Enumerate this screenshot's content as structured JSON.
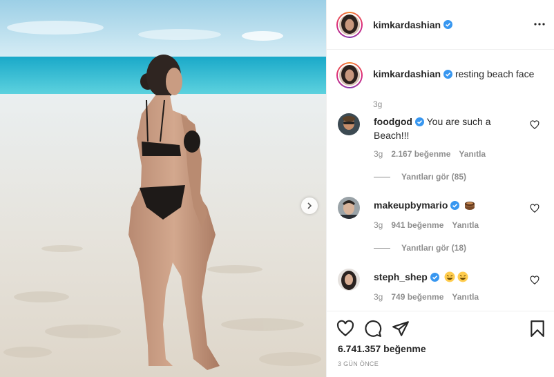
{
  "post": {
    "author": "kimkardashian",
    "verified": true,
    "caption": {
      "username": "kimkardashian",
      "text": "resting beach face",
      "time": "3g"
    },
    "comments": [
      {
        "username": "foodgod",
        "text": "You are such a Beach!!!",
        "time": "3g",
        "likes": "2.167 beğenme",
        "reply_label": "Yanıtla",
        "view_replies": "Yanıtları gör (85)"
      },
      {
        "username": "makeupbymario",
        "text": "",
        "emoji": [
          "cake-emoji"
        ],
        "time": "3g",
        "likes": "941 beğenme",
        "reply_label": "Yanıtla",
        "view_replies": "Yanıtları gör (18)"
      },
      {
        "username": "steph_shep",
        "text": "",
        "emoji": [
          "laughing-emoji",
          "laughing-emoji"
        ],
        "time": "3g",
        "likes": "749 beğenme",
        "reply_label": "Yanıtla"
      }
    ],
    "likes_total": "6.741.357 beğenme",
    "date": "3 GÜN ÖNCE",
    "icons": {
      "more": "more-options-icon",
      "like": "heart-icon",
      "comment": "comment-icon",
      "share": "share-icon",
      "save": "bookmark-icon",
      "next": "chevron-right-icon",
      "verified": "verified-badge-icon"
    },
    "colors": {
      "verified": "#3897f0",
      "text": "#262626",
      "muted": "#8e8e8e",
      "border": "#efefef"
    }
  }
}
